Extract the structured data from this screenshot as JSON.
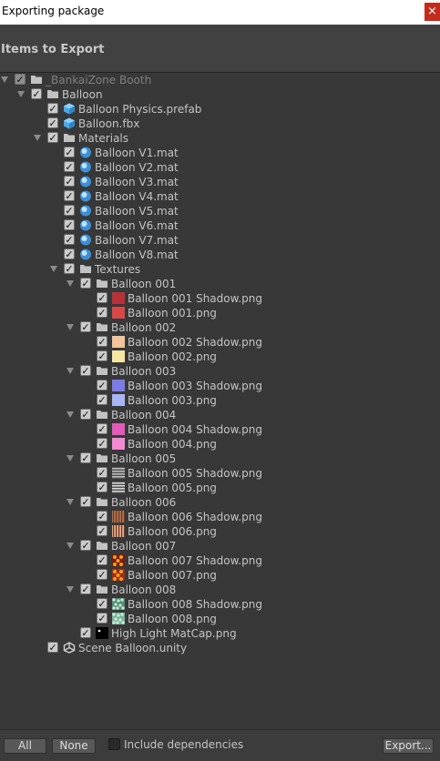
{
  "window": {
    "title": "Exporting package",
    "close_glyph": "×"
  },
  "header": {
    "title": "Items to Export"
  },
  "tree": [
    {
      "label": "_BankaiZone Booth",
      "depth": 0,
      "arrow": true,
      "icon": "folder-icon",
      "dim": true
    },
    {
      "label": "Balloon",
      "depth": 1,
      "arrow": true,
      "icon": "folder-icon"
    },
    {
      "label": "Balloon Physics.prefab",
      "depth": 2,
      "arrow": false,
      "icon": "prefab-icon"
    },
    {
      "label": "Balloon.fbx",
      "depth": 2,
      "arrow": false,
      "icon": "model-icon"
    },
    {
      "label": "Materials",
      "depth": 2,
      "arrow": true,
      "icon": "folder-icon"
    },
    {
      "label": "Balloon V1.mat",
      "depth": 3,
      "arrow": false,
      "icon": "material-icon"
    },
    {
      "label": "Balloon V2.mat",
      "depth": 3,
      "arrow": false,
      "icon": "material-icon"
    },
    {
      "label": "Balloon V3.mat",
      "depth": 3,
      "arrow": false,
      "icon": "material-icon"
    },
    {
      "label": "Balloon V4.mat",
      "depth": 3,
      "arrow": false,
      "icon": "material-icon"
    },
    {
      "label": "Balloon V5.mat",
      "depth": 3,
      "arrow": false,
      "icon": "material-icon"
    },
    {
      "label": "Balloon V6.mat",
      "depth": 3,
      "arrow": false,
      "icon": "material-icon"
    },
    {
      "label": "Balloon V7.mat",
      "depth": 3,
      "arrow": false,
      "icon": "material-icon"
    },
    {
      "label": "Balloon V8.mat",
      "depth": 3,
      "arrow": false,
      "icon": "material-icon"
    },
    {
      "label": "Textures",
      "depth": 3,
      "arrow": true,
      "icon": "folder-icon"
    },
    {
      "label": "Balloon 001",
      "depth": 4,
      "arrow": true,
      "icon": "folder-icon"
    },
    {
      "label": "Balloon 001 Shadow.png",
      "depth": 5,
      "arrow": false,
      "icon": "texture-icon",
      "swatch": "#b8323a"
    },
    {
      "label": "Balloon 001.png",
      "depth": 5,
      "arrow": false,
      "icon": "texture-icon",
      "swatch": "#d94848"
    },
    {
      "label": "Balloon 002",
      "depth": 4,
      "arrow": true,
      "icon": "folder-icon"
    },
    {
      "label": "Balloon 002 Shadow.png",
      "depth": 5,
      "arrow": false,
      "icon": "texture-icon",
      "swatch": "#f2c49a"
    },
    {
      "label": "Balloon 002.png",
      "depth": 5,
      "arrow": false,
      "icon": "texture-icon",
      "swatch": "#f7e6a2"
    },
    {
      "label": "Balloon 003",
      "depth": 4,
      "arrow": true,
      "icon": "folder-icon"
    },
    {
      "label": "Balloon 003 Shadow.png",
      "depth": 5,
      "arrow": false,
      "icon": "texture-icon",
      "swatch": "#7d7ce6"
    },
    {
      "label": "Balloon 003.png",
      "depth": 5,
      "arrow": false,
      "icon": "texture-icon",
      "swatch": "#a9b4f5"
    },
    {
      "label": "Balloon 004",
      "depth": 4,
      "arrow": true,
      "icon": "folder-icon"
    },
    {
      "label": "Balloon 004 Shadow.png",
      "depth": 5,
      "arrow": false,
      "icon": "texture-icon",
      "swatch": "#e35ab8"
    },
    {
      "label": "Balloon 004.png",
      "depth": 5,
      "arrow": false,
      "icon": "texture-icon",
      "swatch": "#f28ad2"
    },
    {
      "label": "Balloon 005",
      "depth": 4,
      "arrow": true,
      "icon": "folder-icon"
    },
    {
      "label": "Balloon 005 Shadow.png",
      "depth": 5,
      "arrow": false,
      "icon": "texture-icon",
      "pattern": "stripes",
      "swatch": "#bdbdbd"
    },
    {
      "label": "Balloon 005.png",
      "depth": 5,
      "arrow": false,
      "icon": "texture-icon",
      "pattern": "stripes",
      "swatch": "#d9d9d9"
    },
    {
      "label": "Balloon 006",
      "depth": 4,
      "arrow": true,
      "icon": "folder-icon"
    },
    {
      "label": "Balloon 006 Shadow.png",
      "depth": 5,
      "arrow": false,
      "icon": "texture-icon",
      "pattern": "vstripes",
      "swatch": "#b0714f"
    },
    {
      "label": "Balloon 006.png",
      "depth": 5,
      "arrow": false,
      "icon": "texture-icon",
      "pattern": "vstripes",
      "swatch": "#e2a98a"
    },
    {
      "label": "Balloon 007",
      "depth": 4,
      "arrow": true,
      "icon": "folder-icon"
    },
    {
      "label": "Balloon 007 Shadow.png",
      "depth": 5,
      "arrow": false,
      "icon": "texture-icon",
      "pattern": "dots",
      "swatch": "#7a1c10"
    },
    {
      "label": "Balloon 007.png",
      "depth": 5,
      "arrow": false,
      "icon": "texture-icon",
      "pattern": "dots",
      "swatch": "#a32a18"
    },
    {
      "label": "Balloon 008",
      "depth": 4,
      "arrow": true,
      "icon": "folder-icon"
    },
    {
      "label": "Balloon 008 Shadow.png",
      "depth": 5,
      "arrow": false,
      "icon": "texture-icon",
      "pattern": "noise",
      "swatch": "#4f8f72"
    },
    {
      "label": "Balloon 008.png",
      "depth": 5,
      "arrow": false,
      "icon": "texture-icon",
      "pattern": "noise",
      "swatch": "#79b59a"
    },
    {
      "label": "High Light MatCap.png",
      "depth": 4,
      "arrow": false,
      "icon": "matcap-icon",
      "swatch": "#000000"
    },
    {
      "label": "Scene Balloon.unity",
      "depth": 2,
      "arrow": false,
      "icon": "unity-scene-icon"
    }
  ],
  "footer": {
    "all_label": "All",
    "none_label": "None",
    "include_dependencies_label": "Include dependencies",
    "export_label": "Export..."
  }
}
